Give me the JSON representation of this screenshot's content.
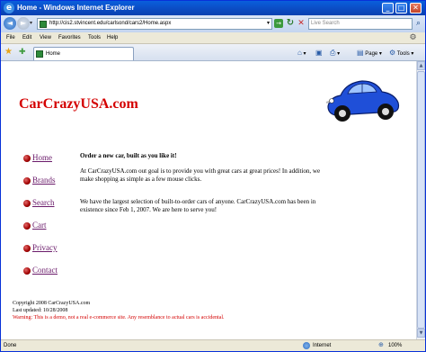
{
  "window": {
    "title": "Home - Windows Internet Explorer",
    "minimize": "_",
    "maximize": "□",
    "close": "✕"
  },
  "addressbar": {
    "back": "◄",
    "forward": "►",
    "dropdown": "▾",
    "url": "http://cis2.stvincent.edu/carlsond/cars2/Home.aspx",
    "go": "→",
    "refresh": "↻",
    "stop": "✕",
    "search_placeholder": "Live Search",
    "search_button": "⌕"
  },
  "menu": [
    "File",
    "Edit",
    "View",
    "Favorites",
    "Tools",
    "Help"
  ],
  "tabbar": {
    "tab_label": "Home",
    "commands": [
      "Page ▾",
      "Tools ▾"
    ],
    "fav_star": "★",
    "fav_add": "✚"
  },
  "site": {
    "title": "CarCrazyUSA.com",
    "nav": [
      "Home",
      "Brands",
      "Search",
      "Cart",
      "Privacy",
      "Contact"
    ],
    "headline": "Order a new car, built as you like it!",
    "para1": "At CarCrazyUSA.com out goal is to provide you with great cars at great prices! In addition, we make shopping as simple as a few mouse clicks.",
    "para2": "We have the largest selection of built-to-order cars of anyone. CarCrazyUSA.com has been in existence since Feb 1, 2007. We are here to serve you!",
    "copyright": "Copyright 2008 CarCrazyUSA.com",
    "updated": "Last updated: 10/28/2008",
    "warning": "Warning: This is a demo, not a real e-commerce site. Any resemblance to actual cars is accidental."
  },
  "status": {
    "text": "Done",
    "zone": "Internet",
    "zoom": "100%"
  },
  "colors": {
    "title_red": "#d40000",
    "link_purple": "#6a1a6a",
    "car_blue": "#1f4fd8"
  }
}
